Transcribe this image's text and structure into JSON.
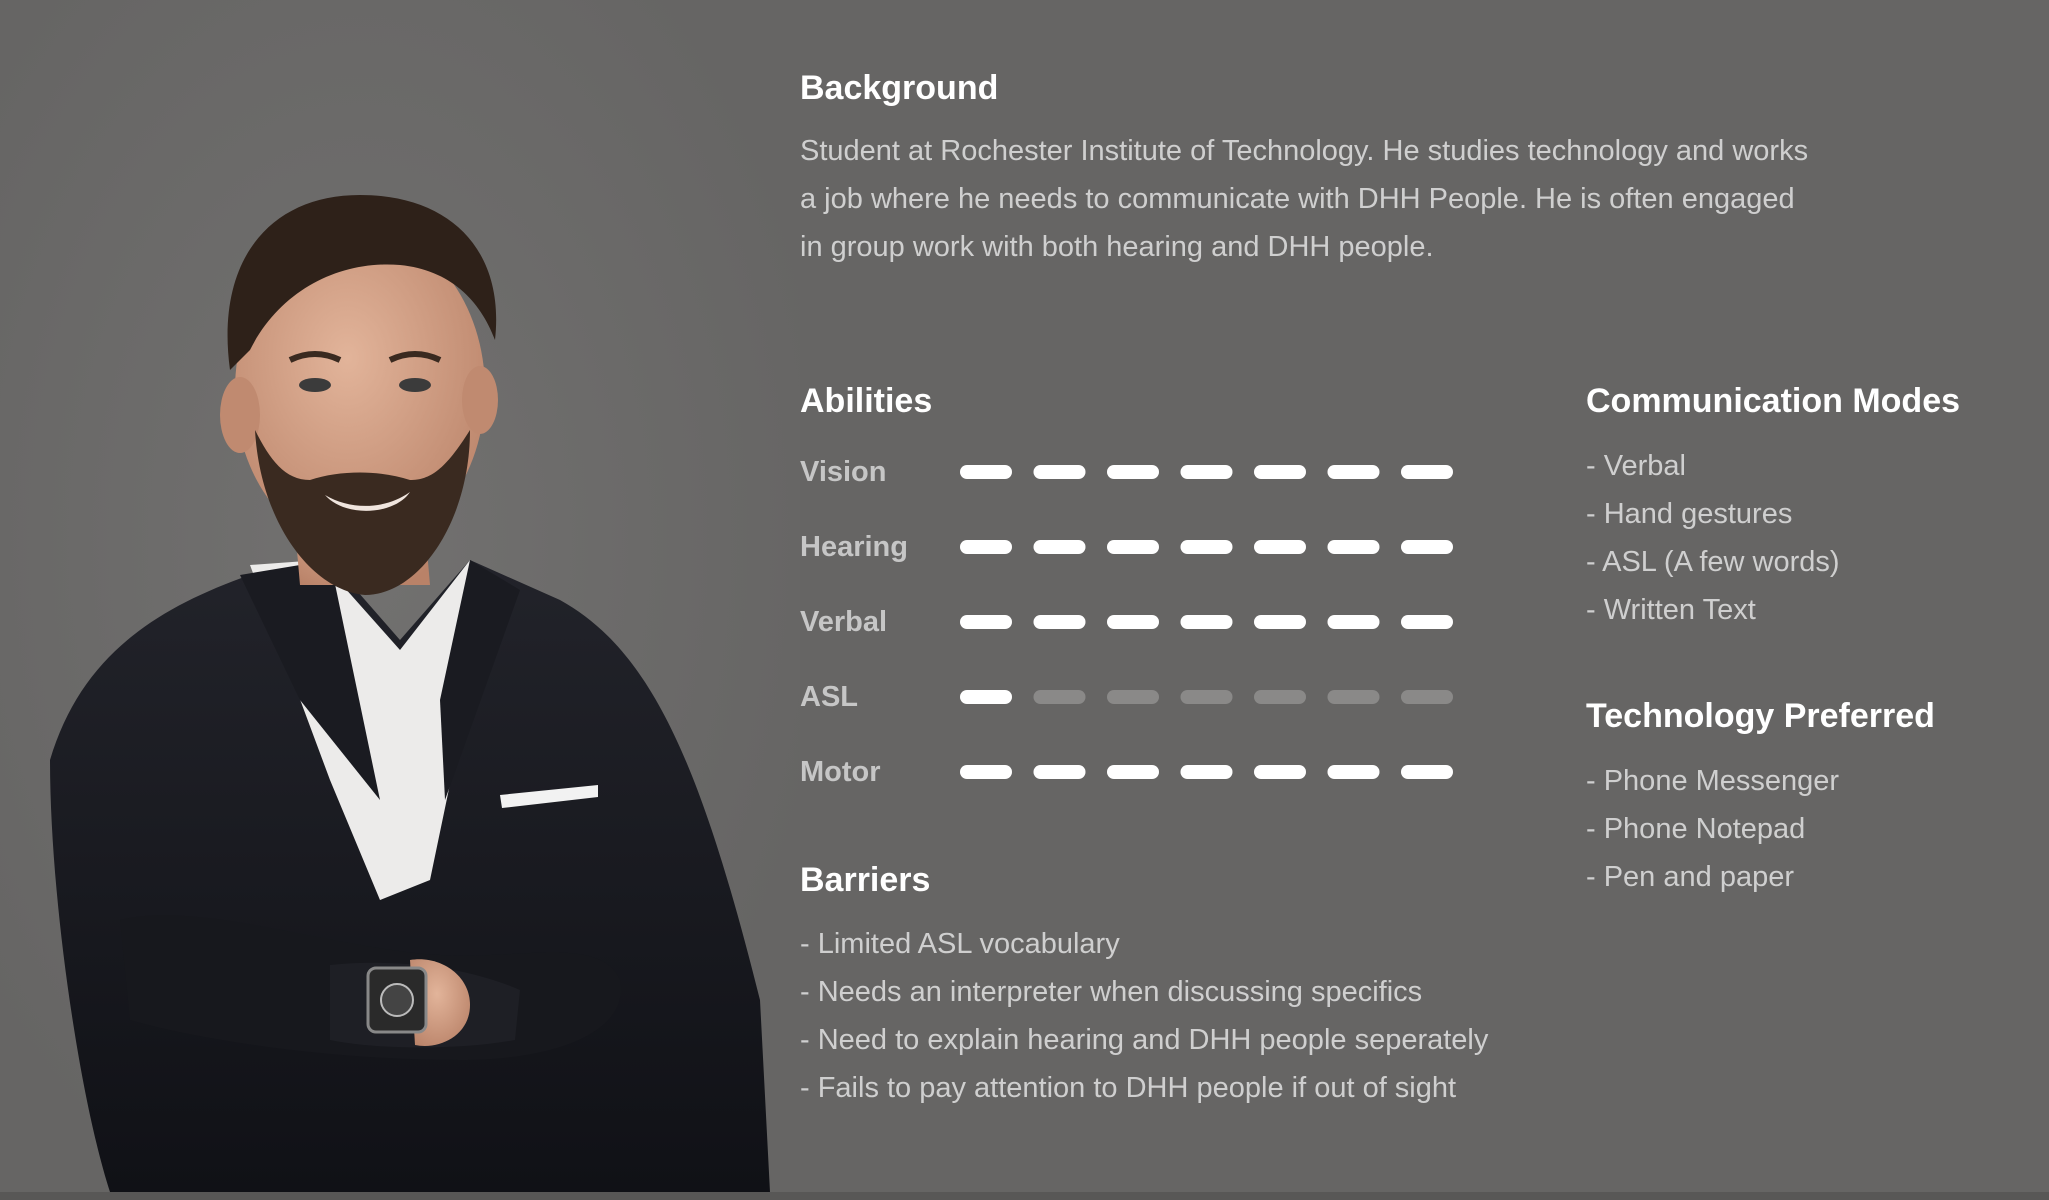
{
  "background": {
    "title": "Background",
    "lines": [
      "Student at Rochester Institute of Technology. He studies technology and works",
      "a job where he needs to communicate with DHH People. He is often engaged",
      "in group work with both hearing and DHH people."
    ]
  },
  "abilities": {
    "title": "Abilities",
    "scale_max": 7,
    "items": [
      {
        "label": "Vision",
        "level": 7
      },
      {
        "label": "Hearing",
        "level": 7
      },
      {
        "label": "Verbal",
        "level": 7
      },
      {
        "label": "ASL",
        "level": 1
      },
      {
        "label": "Motor",
        "level": 7
      }
    ]
  },
  "barriers": {
    "title": "Barriers",
    "items": [
      "- Limited ASL vocabulary",
      "- Needs an interpreter when discussing specifics",
      "- Need to explain hearing and DHH people seperately",
      "- Fails to pay attention to DHH people if out of sight"
    ]
  },
  "communication_modes": {
    "title": "Communication Modes",
    "items": [
      "- Verbal",
      "- Hand gestures",
      "- ASL (A few words)",
      "- Written Text"
    ]
  },
  "technology_preferred": {
    "title": "Technology Preferred",
    "items": [
      "- Phone Messenger",
      "- Phone Notepad",
      "- Pen and paper"
    ]
  },
  "colors": {
    "page_bg": "#666564",
    "bar_active": "#ffffff",
    "bar_inactive": "#8a8988"
  },
  "icons": {
    "portrait": "person-portrait"
  }
}
